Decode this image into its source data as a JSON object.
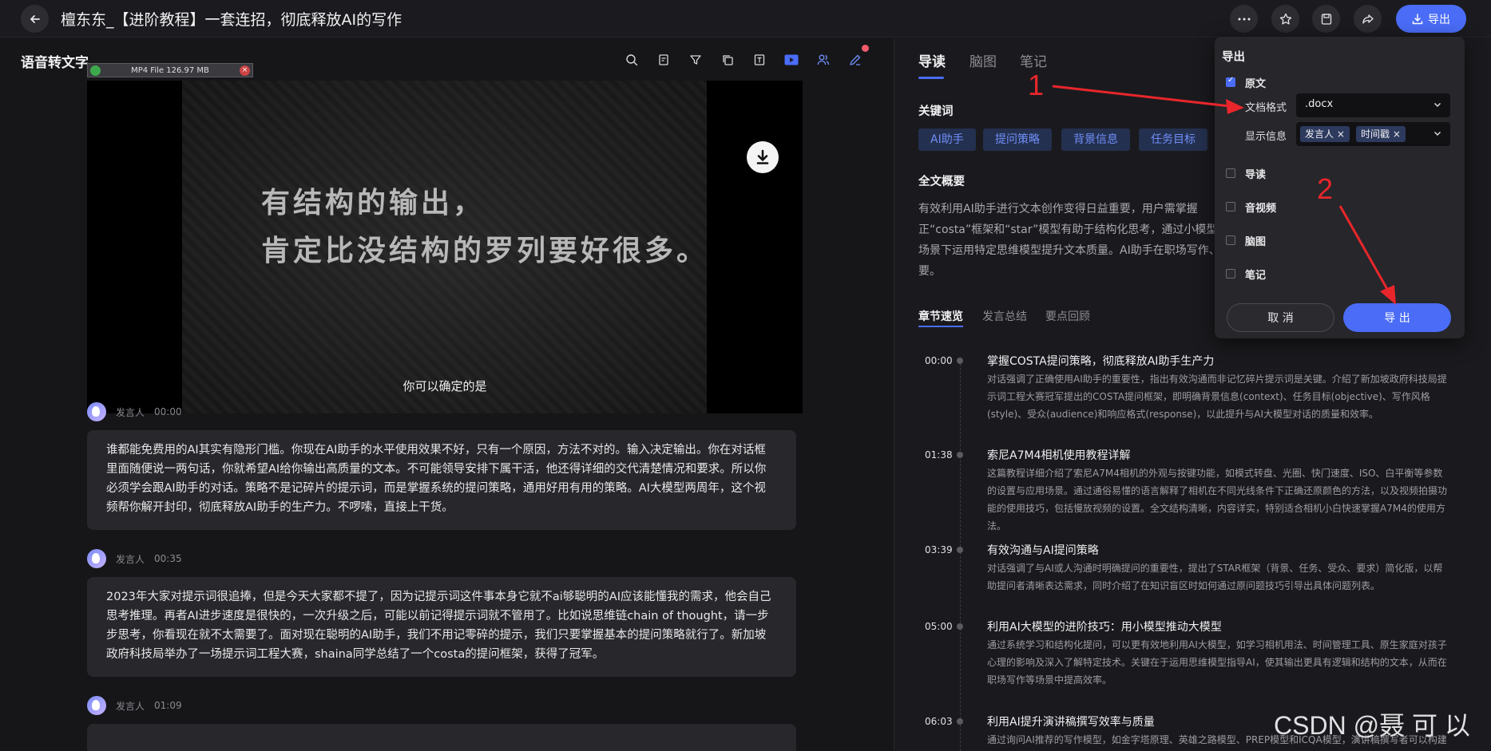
{
  "header": {
    "title": "檀东东_【进阶教程】一套连招，彻底释放AI的写作",
    "export_label": "导出"
  },
  "left": {
    "section_title": "语音转文字",
    "file_chip": "MP4 File 126.97 MB",
    "video": {
      "line1": "有结构的输出，",
      "line2": "肯定比没结构的罗列要好很多。",
      "subtitle": "你可以确定的是"
    },
    "transcript": [
      {
        "speaker": "发言人",
        "time": "00:00",
        "text": "谁都能免费用的AI其实有隐形门槛。你现在AI助手的水平使用效果不好，只有一个原因，方法不对的。输入决定输出。你在对话框里面随便说一两句话，你就希望AI给你输出高质量的文本。不可能领导安排下属干活，他还得详细的交代清楚情况和要求。所以你必须学会跟AI助手的对话。策略不是记碎片的提示词，而是掌握系统的提问策略，通用好用有用的策略。AI大模型两周年，这个视频帮你解开封印，彻底释放AI助手的生产力。不啰嗦，直接上干货。"
      },
      {
        "speaker": "发言人",
        "time": "00:35",
        "text": "2023年大家对提示词很追捧，但是今天大家都不提了，因为记提示词这件事本身它就不ai够聪明的AI应该能懂我的需求，他会自己思考推理。再者AI进步速度是很快的，一次升级之后，可能以前记得提示词就不管用了。比如说思维链chain of thought，请一步步思考，你看现在就不太需要了。面对现在聪明的AI助手，我们不用记零碎的提示，我们只要掌握基本的提问策略就行了。新加坡政府科技局举办了一场提示词工程大赛，shaina同学总结了一个costa的提问框架，获得了冠军。"
      },
      {
        "speaker": "发言人",
        "time": "01:09",
        "text": ""
      }
    ]
  },
  "right": {
    "tabs": [
      "导读",
      "脑图",
      "笔记"
    ],
    "keywords_heading": "关键词",
    "keywords": [
      "AI助手",
      "提问策略",
      "背景信息",
      "任务目标"
    ],
    "summary_heading": "全文概要",
    "summary": "有效利用AI助手进行文本创作变得日益重要，用户需掌握正“costa”框架和“star”模型有助于结构化思考，通过小模型推动场景下运用特定思维模型提升文本质量。AI助手在职场写作、关重要。",
    "chapter_tabs": [
      "章节速览",
      "发言总结",
      "要点回顾"
    ],
    "chapters": [
      {
        "time": "00:00",
        "title": "掌握COSTA提问策略，彻底释放AI助手生产力",
        "desc": "对话强调了正确使用AI助手的重要性，指出有效沟通而非记忆碎片提示词是关键。介绍了新加坡政府科技局提示词工程大赛冠军提出的COSTA提问框架，即明确背景信息(context)、任务目标(objective)、写作风格(style)、受众(audience)和响应格式(response)，以此提升与AI大模型对话的质量和效率。"
      },
      {
        "time": "01:38",
        "title": "索尼A7M4相机使用教程详解",
        "desc": "这篇教程详细介绍了索尼A7M4相机的外观与按键功能，如模式转盘、光圈、快门速度、ISO、白平衡等参数的设置与应用场景。通过通俗易懂的语言解释了相机在不同光线条件下正确还原颜色的方法，以及视频拍摄功能的使用技巧，包括慢放视频的设置。全文结构清晰，内容详实，特别适合相机小白快速掌握A7M4的使用方法。"
      },
      {
        "time": "03:39",
        "title": "有效沟通与AI提问策略",
        "desc": "对话强调了与AI或人沟通时明确提问的重要性，提出了STAR框架（背景、任务、受众、要求）简化版，以帮助提问者清晰表达需求，同时介绍了在知识盲区时如何通过原问题技巧引导出具体问题列表。"
      },
      {
        "time": "05:00",
        "title": "利用AI大模型的进阶技巧：用小模型推动大模型",
        "desc": "通过系统学习和结构化提问，可以更有效地利用AI大模型，如学习相机用法、时间管理工具、原生家庭对孩子心理的影响及深入了解特定技术。关键在于运用思维模型指导AI，使其输出更具有逻辑和结构的文本，从而在职场写作等场景中提高效率。"
      },
      {
        "time": "06:03",
        "title": "利用AI提升演讲稿撰写效率与质量",
        "desc": "通过询问AI推荐的写作模型，如金字塔原理、英雄之路模型、PREP模型和ICQA模型，演讲稿撰写者可以构建"
      }
    ]
  },
  "export_popup": {
    "title": "导出",
    "original_label": "原文",
    "format_label": "文档格式",
    "format_value": ".docx",
    "display_label": "显示信息",
    "display_tags": [
      "发言人",
      "时间戳"
    ],
    "options": [
      "导读",
      "音视频",
      "脑图",
      "笔记"
    ],
    "cancel_label": "取 消",
    "export_label": "导 出"
  },
  "annotations": {
    "num1": "1",
    "num2": "2",
    "color": "#e8262b"
  },
  "watermark": "CSDN @聂 可 以"
}
